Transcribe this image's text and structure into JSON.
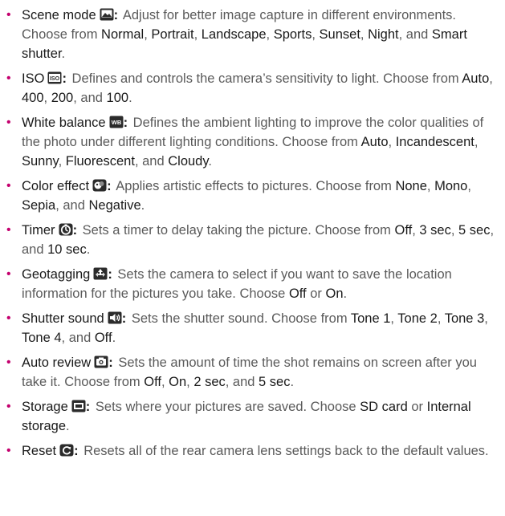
{
  "items": [
    {
      "term": "Scene mode",
      "icon": "scene-mode-icon",
      "parts": [
        {
          "t": "Adjust for better image capture in different environments. Choose from "
        },
        {
          "t": "Normal",
          "o": 1
        },
        {
          "t": ", "
        },
        {
          "t": "Portrait",
          "o": 1
        },
        {
          "t": ", "
        },
        {
          "t": "Landscape",
          "o": 1
        },
        {
          "t": ", "
        },
        {
          "t": "Sports",
          "o": 1
        },
        {
          "t": ", "
        },
        {
          "t": "Sunset",
          "o": 1
        },
        {
          "t": ", "
        },
        {
          "t": "Night",
          "o": 1
        },
        {
          "t": ", and "
        },
        {
          "t": "Smart shutter",
          "o": 1
        },
        {
          "t": "."
        }
      ]
    },
    {
      "term": "ISO",
      "icon": "iso-icon",
      "icon_text": "ISO",
      "parts": [
        {
          "t": "Defines and controls the camera’s sensitivity to light. Choose from "
        },
        {
          "t": "Auto",
          "o": 1
        },
        {
          "t": ", "
        },
        {
          "t": "400",
          "o": 1
        },
        {
          "t": ", "
        },
        {
          "t": "200",
          "o": 1
        },
        {
          "t": ", and "
        },
        {
          "t": "100",
          "o": 1
        },
        {
          "t": "."
        }
      ]
    },
    {
      "term": "White balance",
      "icon": "white-balance-icon",
      "icon_text": "WB",
      "parts": [
        {
          "t": "Defines the ambient lighting to improve the color qualities of the photo under different lighting conditions. Choose from "
        },
        {
          "t": "Auto",
          "o": 1
        },
        {
          "t": ", "
        },
        {
          "t": "Incandescent",
          "o": 1
        },
        {
          "t": ", "
        },
        {
          "t": "Sunny",
          "o": 1
        },
        {
          "t": ", "
        },
        {
          "t": "Fluorescent",
          "o": 1
        },
        {
          "t": ", and "
        },
        {
          "t": "Cloudy",
          "o": 1
        },
        {
          "t": "."
        }
      ]
    },
    {
      "term": "Color effect",
      "icon": "color-effect-icon",
      "parts": [
        {
          "t": "Applies artistic effects to pictures. Choose from "
        },
        {
          "t": "None",
          "o": 1
        },
        {
          "t": ", "
        },
        {
          "t": "Mono",
          "o": 1
        },
        {
          "t": ", "
        },
        {
          "t": "Sepia",
          "o": 1
        },
        {
          "t": ", and "
        },
        {
          "t": "Negative",
          "o": 1
        },
        {
          "t": "."
        }
      ]
    },
    {
      "term": "Timer",
      "icon": "timer-icon",
      "parts": [
        {
          "t": "Sets a timer to delay taking the picture. Choose from "
        },
        {
          "t": "Off",
          "o": 1
        },
        {
          "t": ", "
        },
        {
          "t": "3 sec",
          "o": 1
        },
        {
          "t": ", "
        },
        {
          "t": "5 sec",
          "o": 1
        },
        {
          "t": ", and "
        },
        {
          "t": "10 sec",
          "o": 1
        },
        {
          "t": "."
        }
      ]
    },
    {
      "term": "Geotagging",
      "icon": "geotagging-icon",
      "parts": [
        {
          "t": "Sets the camera to select if you want to save the location information for the pictures you take. Choose "
        },
        {
          "t": "Off",
          "o": 1
        },
        {
          "t": " or "
        },
        {
          "t": "On",
          "o": 1
        },
        {
          "t": "."
        }
      ]
    },
    {
      "term": "Shutter sound",
      "icon": "shutter-sound-icon",
      "parts": [
        {
          "t": "Sets the shutter sound. Choose from "
        },
        {
          "t": "Tone 1",
          "o": 1
        },
        {
          "t": ", "
        },
        {
          "t": "Tone 2",
          "o": 1
        },
        {
          "t": ", "
        },
        {
          "t": "Tone 3",
          "o": 1
        },
        {
          "t": ", "
        },
        {
          "t": "Tone 4",
          "o": 1
        },
        {
          "t": ", and "
        },
        {
          "t": "Off",
          "o": 1
        },
        {
          "t": "."
        }
      ]
    },
    {
      "term": "Auto review",
      "icon": "auto-review-icon",
      "parts": [
        {
          "t": "Sets the amount of time the shot remains on screen after you take it. Choose from "
        },
        {
          "t": "Off",
          "o": 1
        },
        {
          "t": ", "
        },
        {
          "t": "On",
          "o": 1
        },
        {
          "t": ", "
        },
        {
          "t": "2 sec",
          "o": 1
        },
        {
          "t": ", and "
        },
        {
          "t": "5 sec",
          "o": 1
        },
        {
          "t": "."
        }
      ]
    },
    {
      "term": "Storage",
      "icon": "storage-icon",
      "parts": [
        {
          "t": "Sets where your pictures are saved. Choose "
        },
        {
          "t": "SD card",
          "o": 1
        },
        {
          "t": " or "
        },
        {
          "t": "Internal storage",
          "o": 1
        },
        {
          "t": "."
        }
      ]
    },
    {
      "term": "Reset",
      "icon": "reset-icon",
      "parts": [
        {
          "t": "Resets all of the rear camera lens settings back to the default values."
        }
      ]
    }
  ],
  "colors": {
    "bullet": "#c4006e",
    "body_text": "#5a5a5a",
    "option_text": "#1a1a1a",
    "icon_fill": "#2b2b2b"
  }
}
